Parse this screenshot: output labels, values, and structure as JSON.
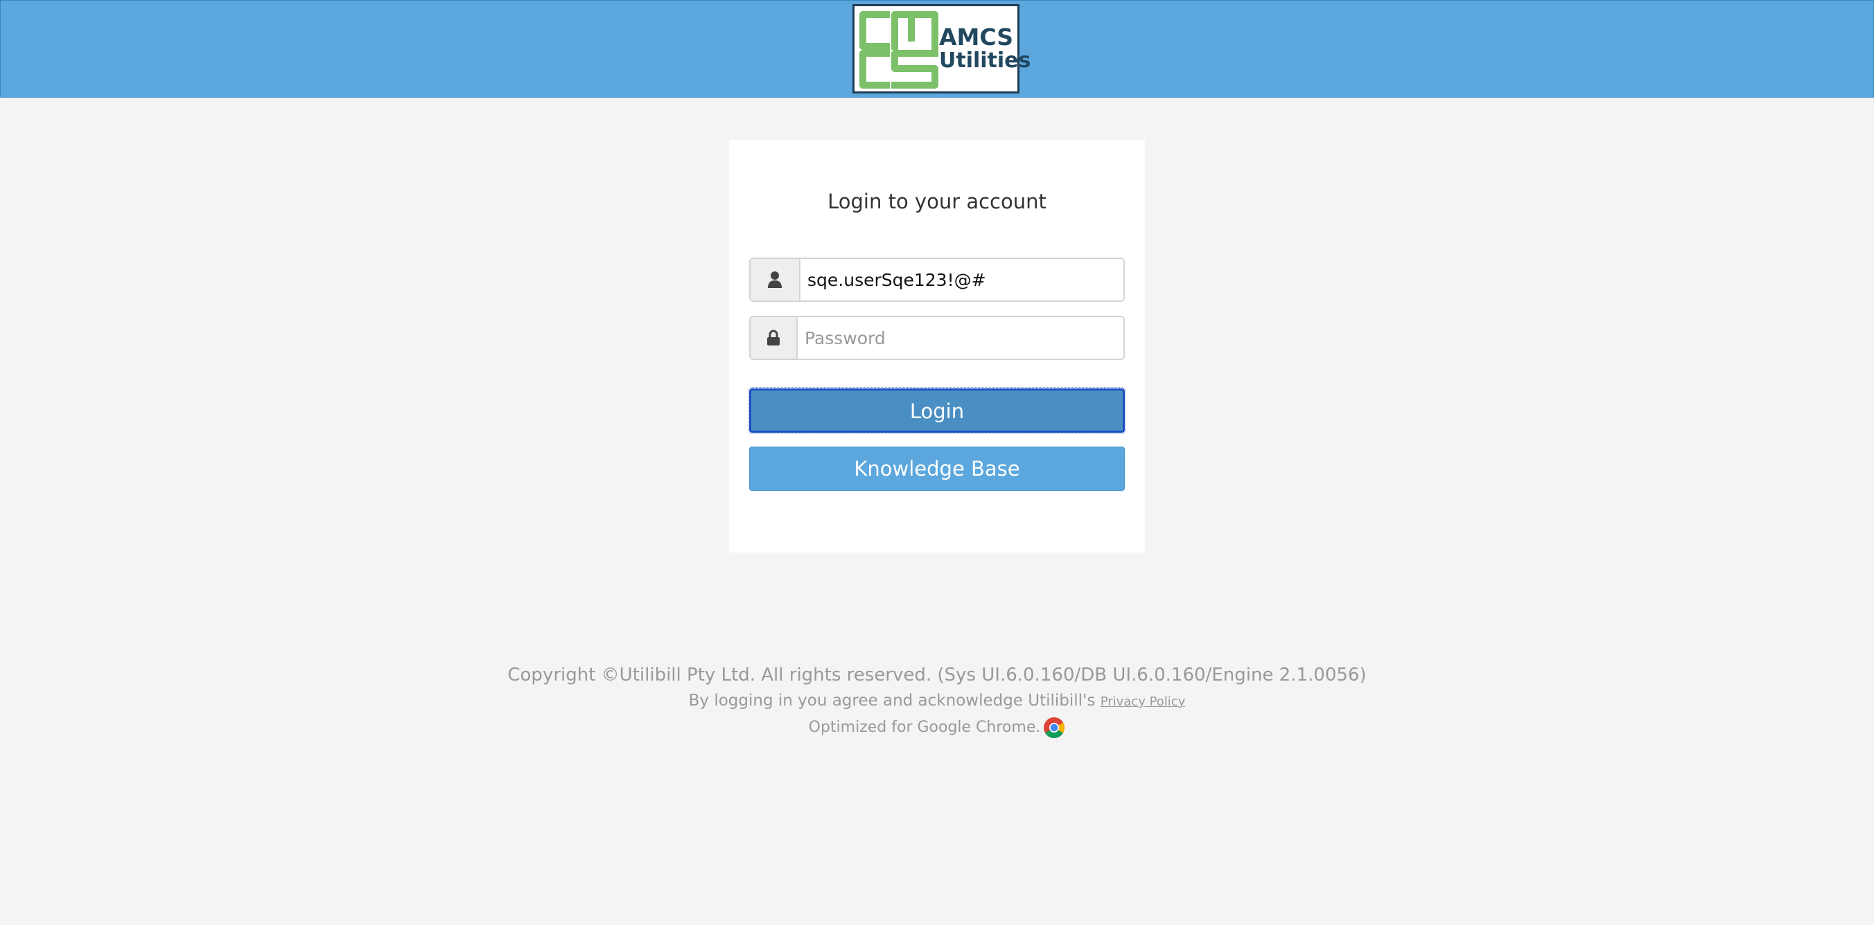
{
  "header": {
    "logo": {
      "line1": "AMCS",
      "line2": "Utilities",
      "color": "#7cc06a"
    },
    "background": "#5ba7de"
  },
  "login": {
    "title": "Login to your account",
    "username": {
      "value": "sqe.userSqe123!@#",
      "icon": "user-icon"
    },
    "password": {
      "placeholder": "Password",
      "icon": "lock-icon"
    },
    "login_button": "Login",
    "kb_button": "Knowledge Base"
  },
  "footer": {
    "copyright": "Copyright ©Utilibill Pty Ltd. All rights reserved. (Sys UI.6.0.160/DB UI.6.0.160/Engine 2.1.0056)",
    "agree_text": "By logging in you agree and acknowledge Utilibill's",
    "privacy_link": "Privacy Policy",
    "optimized": "Optimized for Google Chrome.",
    "browser_icon": "chrome-icon"
  }
}
